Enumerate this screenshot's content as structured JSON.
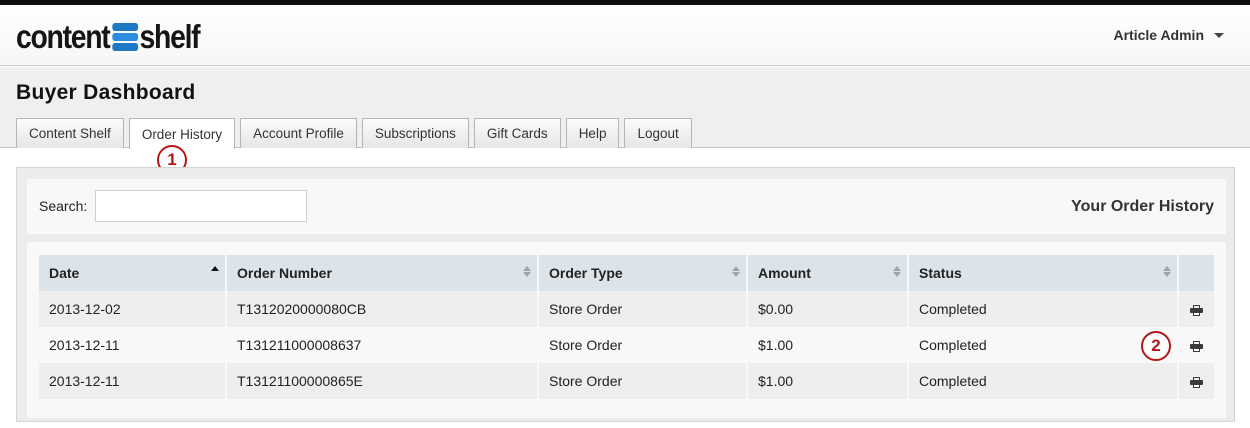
{
  "brand": {
    "logo_left": "content",
    "logo_right": "shelf"
  },
  "user_menu": {
    "label": "Article Admin"
  },
  "page": {
    "title": "Buyer Dashboard"
  },
  "tabs": [
    {
      "label": "Content Shelf",
      "active": false
    },
    {
      "label": "Order History",
      "active": true
    },
    {
      "label": "Account Profile",
      "active": false
    },
    {
      "label": "Subscriptions",
      "active": false
    },
    {
      "label": "Gift Cards",
      "active": false
    },
    {
      "label": "Help",
      "active": false
    },
    {
      "label": "Logout",
      "active": false
    }
  ],
  "markers": {
    "first": "1",
    "second": "2"
  },
  "search": {
    "label": "Search:",
    "value": "",
    "placeholder": ""
  },
  "panel": {
    "heading": "Your Order History"
  },
  "table": {
    "columns": [
      "Date",
      "Order Number",
      "Order Type",
      "Amount",
      "Status",
      ""
    ],
    "sorted_column": "Date",
    "sort_direction": "ascending",
    "rows": [
      {
        "date": "2013-12-02",
        "order_number": "T1312020000080CB",
        "order_type": "Store Order",
        "amount": "$0.00",
        "status": "Completed",
        "action_icon": "print-icon"
      },
      {
        "date": "2013-12-11",
        "order_number": "T131211000008637",
        "order_type": "Store Order",
        "amount": "$1.00",
        "status": "Completed",
        "action_icon": "print-icon"
      },
      {
        "date": "2013-12-11",
        "order_number": "T13121100000865E",
        "order_type": "Store Order",
        "amount": "$1.00",
        "status": "Completed",
        "action_icon": "print-icon"
      }
    ]
  },
  "colors": {
    "brand_blue": "#1f78c4",
    "annotation_red": "#b21818",
    "header_row": "#dce4ea"
  }
}
